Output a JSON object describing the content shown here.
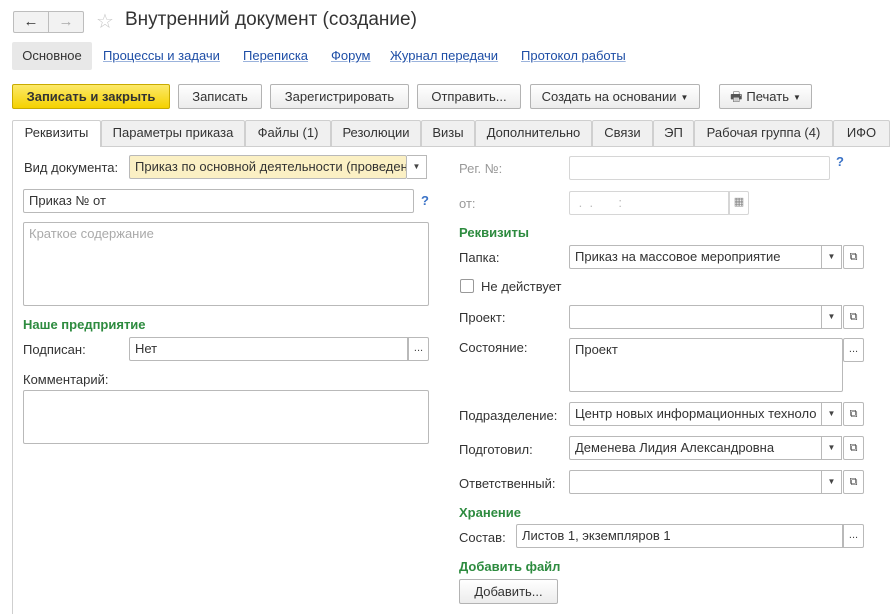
{
  "window": {
    "title": "Внутренний документ (создание)",
    "back_icon": "←",
    "forward_icon": "→",
    "star_icon": "☆"
  },
  "sections": {
    "active": "Основное",
    "links": [
      "Процессы и задачи",
      "Переписка",
      "Форум",
      "Журнал передачи",
      "Протокол работы"
    ]
  },
  "toolbar": {
    "save_close": "Записать и закрыть",
    "save": "Записать",
    "register": "Зарегистрировать",
    "send": "Отправить...",
    "create_based": "Создать на основании",
    "print": "Печать"
  },
  "tabs": [
    "Реквизиты",
    "Параметры приказа",
    "Файлы (1)",
    "Резолюции",
    "Визы",
    "Дополнительно",
    "Связи",
    "ЭП",
    "Рабочая группа (4)",
    "ИФО"
  ],
  "left": {
    "doc_type_label": "Вид документа:",
    "doc_type_value": "Приказ по основной деятельности (проведение",
    "title_value": "Приказ №  от",
    "summary_placeholder": "Краткое содержание",
    "org_group": "Наше предприятие",
    "signed_label": "Подписан:",
    "signed_value": "Нет",
    "comment_label": "Комментарий:"
  },
  "right": {
    "reg_no_label": "Рег. №:",
    "date_label": "от:",
    "date_value": " .  .       :",
    "requisites_group": "Реквизиты",
    "folder_label": "Папка:",
    "folder_value": "Приказ на массовое мероприятие",
    "inactive_label": "Не действует",
    "project_label": "Проект:",
    "state_label": "Состояние:",
    "state_value": "Проект",
    "division_label": "Подразделение:",
    "division_value": "Центр новых информационных техноло",
    "prepared_label": "Подготовил:",
    "prepared_value": "Деменева Лидия Александровна",
    "responsible_label": "Ответственный:",
    "storage_group": "Хранение",
    "composition_label": "Состав:",
    "composition_value": "Листов 1, экземпляров 1",
    "add_file_group": "Добавить файл",
    "add_button": "Добавить..."
  },
  "icons": {
    "dropdown": "▼",
    "ellipsis": "...",
    "open": "⧉",
    "help": "?",
    "calendar": "▦",
    "printer": "🖶"
  }
}
